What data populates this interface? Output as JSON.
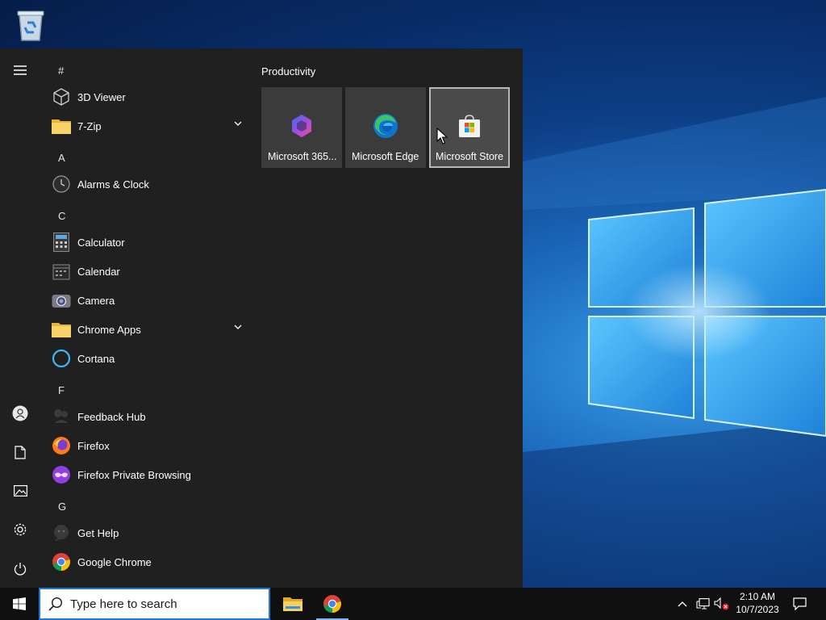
{
  "desktop": {
    "icons": [
      {
        "name": "recycle-bin",
        "label": ""
      }
    ]
  },
  "start_menu": {
    "rail": [
      "hamburger-icon",
      "user-icon",
      "document-icon",
      "pictures-icon",
      "settings-icon",
      "power-icon"
    ],
    "groups": {
      "hash": "#",
      "a": "A",
      "c": "C",
      "f": "F",
      "g": "G"
    },
    "apps": {
      "viewer_3d": "3D Viewer",
      "zip7": "7-Zip",
      "alarms": "Alarms & Clock",
      "calculator": "Calculator",
      "calendar": "Calendar",
      "camera": "Camera",
      "chrome_apps": "Chrome Apps",
      "cortana": "Cortana",
      "feedback": "Feedback Hub",
      "firefox": "Firefox",
      "firefox_private": "Firefox Private Browsing",
      "get_help": "Get Help",
      "chrome": "Google Chrome"
    },
    "tiles": {
      "heading": "Productivity",
      "items": [
        {
          "label": "Microsoft 365...",
          "icon": "microsoft-365-icon"
        },
        {
          "label": "Microsoft Edge",
          "icon": "edge-icon"
        },
        {
          "label": "Microsoft Store",
          "icon": "store-icon"
        }
      ]
    }
  },
  "taskbar": {
    "search_placeholder": "Type here to search",
    "pinned": [
      {
        "name": "file-explorer",
        "running": false
      },
      {
        "name": "google-chrome",
        "running": true
      }
    ],
    "clock": {
      "time": "2:10 AM",
      "date": "10/7/2023"
    }
  },
  "colors": {
    "menu_bg": "#202020",
    "tile_bg": "#3b3b3b",
    "taskbar_bg": "#101010",
    "search_border": "#1e78d4",
    "accent": "#76b9ed"
  }
}
